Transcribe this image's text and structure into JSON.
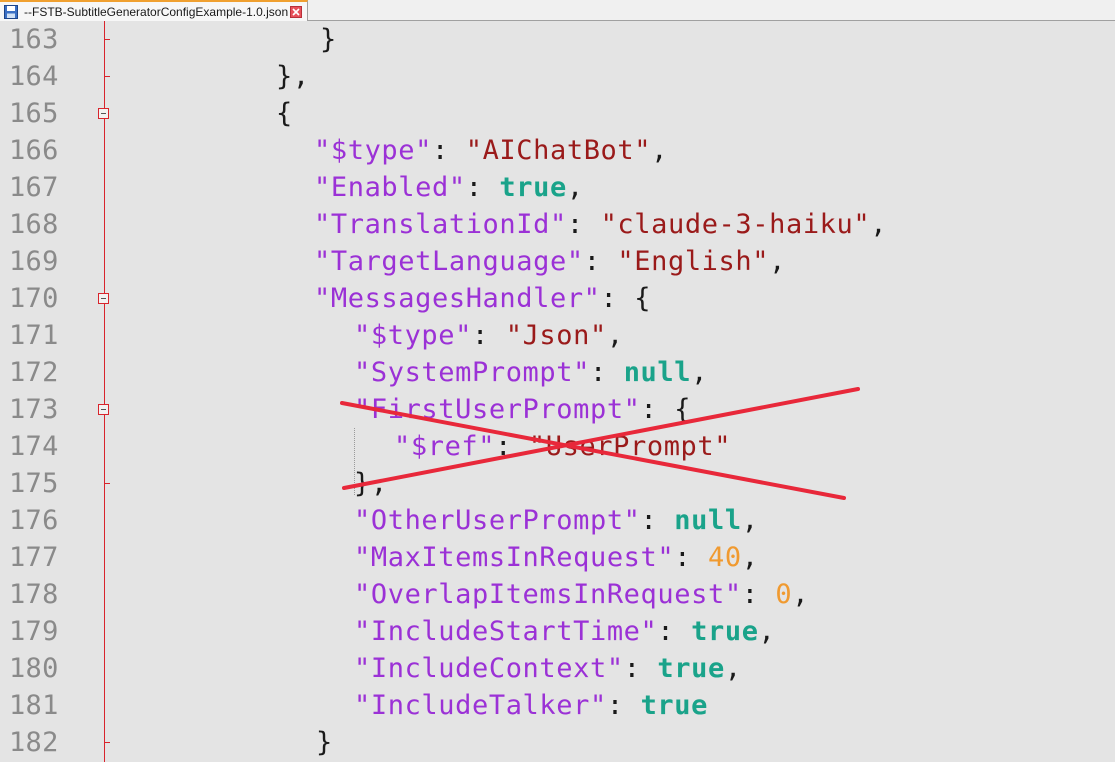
{
  "tab": {
    "title": "--FSTB-SubtitleGeneratorConfigExample-1.0.json",
    "file_icon": "floppy-disk-icon",
    "close_icon": "close-icon"
  },
  "colors": {
    "key": "#9b31d6",
    "string": "#9a1a1a",
    "keyword": "#1aa38a",
    "number": "#f09a30",
    "fold_margin": "#d8242c",
    "strike": "#e8283a"
  },
  "lines": [
    {
      "num": "163",
      "tokens": [
        {
          "t": "}",
          "c": "punct"
        }
      ]
    },
    {
      "num": "164",
      "tokens": [
        {
          "t": "},",
          "c": "punct"
        }
      ]
    },
    {
      "num": "165",
      "tokens": [
        {
          "t": "{",
          "c": "punct"
        }
      ]
    },
    {
      "num": "166",
      "tokens": [
        {
          "t": "\"$type\"",
          "c": "key"
        },
        {
          "t": ": ",
          "c": "punct"
        },
        {
          "t": "\"AIChatBot\"",
          "c": "str"
        },
        {
          "t": ",",
          "c": "punct"
        }
      ]
    },
    {
      "num": "167",
      "tokens": [
        {
          "t": "\"Enabled\"",
          "c": "key"
        },
        {
          "t": ": ",
          "c": "punct"
        },
        {
          "t": "true",
          "c": "kw"
        },
        {
          "t": ",",
          "c": "punct"
        }
      ]
    },
    {
      "num": "168",
      "tokens": [
        {
          "t": "\"TranslationId\"",
          "c": "key"
        },
        {
          "t": ": ",
          "c": "punct"
        },
        {
          "t": "\"claude-3-haiku\"",
          "c": "str"
        },
        {
          "t": ",",
          "c": "punct"
        }
      ]
    },
    {
      "num": "169",
      "tokens": [
        {
          "t": "\"TargetLanguage\"",
          "c": "key"
        },
        {
          "t": ": ",
          "c": "punct"
        },
        {
          "t": "\"English\"",
          "c": "str"
        },
        {
          "t": ",",
          "c": "punct"
        }
      ]
    },
    {
      "num": "170",
      "tokens": [
        {
          "t": "\"MessagesHandler\"",
          "c": "key"
        },
        {
          "t": ": {",
          "c": "punct"
        }
      ]
    },
    {
      "num": "171",
      "tokens": [
        {
          "t": "\"$type\"",
          "c": "key"
        },
        {
          "t": ": ",
          "c": "punct"
        },
        {
          "t": "\"Json\"",
          "c": "str"
        },
        {
          "t": ",",
          "c": "punct"
        }
      ]
    },
    {
      "num": "172",
      "tokens": [
        {
          "t": "\"SystemPrompt\"",
          "c": "key"
        },
        {
          "t": ": ",
          "c": "punct"
        },
        {
          "t": "null",
          "c": "kw"
        },
        {
          "t": ",",
          "c": "punct"
        }
      ]
    },
    {
      "num": "173",
      "tokens": [
        {
          "t": "\"FirstUserPrompt\"",
          "c": "key"
        },
        {
          "t": ": {",
          "c": "punct"
        }
      ]
    },
    {
      "num": "174",
      "tokens": [
        {
          "t": "\"$ref\"",
          "c": "key"
        },
        {
          "t": ": ",
          "c": "punct"
        },
        {
          "t": "\"UserPrompt\"",
          "c": "str"
        }
      ]
    },
    {
      "num": "175",
      "tokens": [
        {
          "t": "},",
          "c": "punct"
        }
      ]
    },
    {
      "num": "176",
      "tokens": [
        {
          "t": "\"OtherUserPrompt\"",
          "c": "key"
        },
        {
          "t": ": ",
          "c": "punct"
        },
        {
          "t": "null",
          "c": "kw"
        },
        {
          "t": ",",
          "c": "punct"
        }
      ]
    },
    {
      "num": "177",
      "tokens": [
        {
          "t": "\"MaxItemsInRequest\"",
          "c": "key"
        },
        {
          "t": ": ",
          "c": "punct"
        },
        {
          "t": "40",
          "c": "num"
        },
        {
          "t": ",",
          "c": "punct"
        }
      ]
    },
    {
      "num": "178",
      "tokens": [
        {
          "t": "\"OverlapItemsInRequest\"",
          "c": "key"
        },
        {
          "t": ": ",
          "c": "punct"
        },
        {
          "t": "0",
          "c": "num"
        },
        {
          "t": ",",
          "c": "punct"
        }
      ]
    },
    {
      "num": "179",
      "tokens": [
        {
          "t": "\"IncludeStartTime\"",
          "c": "key"
        },
        {
          "t": ": ",
          "c": "punct"
        },
        {
          "t": "true",
          "c": "kw"
        },
        {
          "t": ",",
          "c": "punct"
        }
      ]
    },
    {
      "num": "180",
      "tokens": [
        {
          "t": "\"IncludeContext\"",
          "c": "key"
        },
        {
          "t": ": ",
          "c": "punct"
        },
        {
          "t": "true",
          "c": "kw"
        },
        {
          "t": ",",
          "c": "punct"
        }
      ]
    },
    {
      "num": "181",
      "tokens": [
        {
          "t": "\"IncludeTalker\"",
          "c": "key"
        },
        {
          "t": ": ",
          "c": "punct"
        },
        {
          "t": "true",
          "c": "kw"
        }
      ]
    },
    {
      "num": "182",
      "tokens": [
        {
          "t": "}",
          "c": "punct"
        }
      ]
    }
  ]
}
